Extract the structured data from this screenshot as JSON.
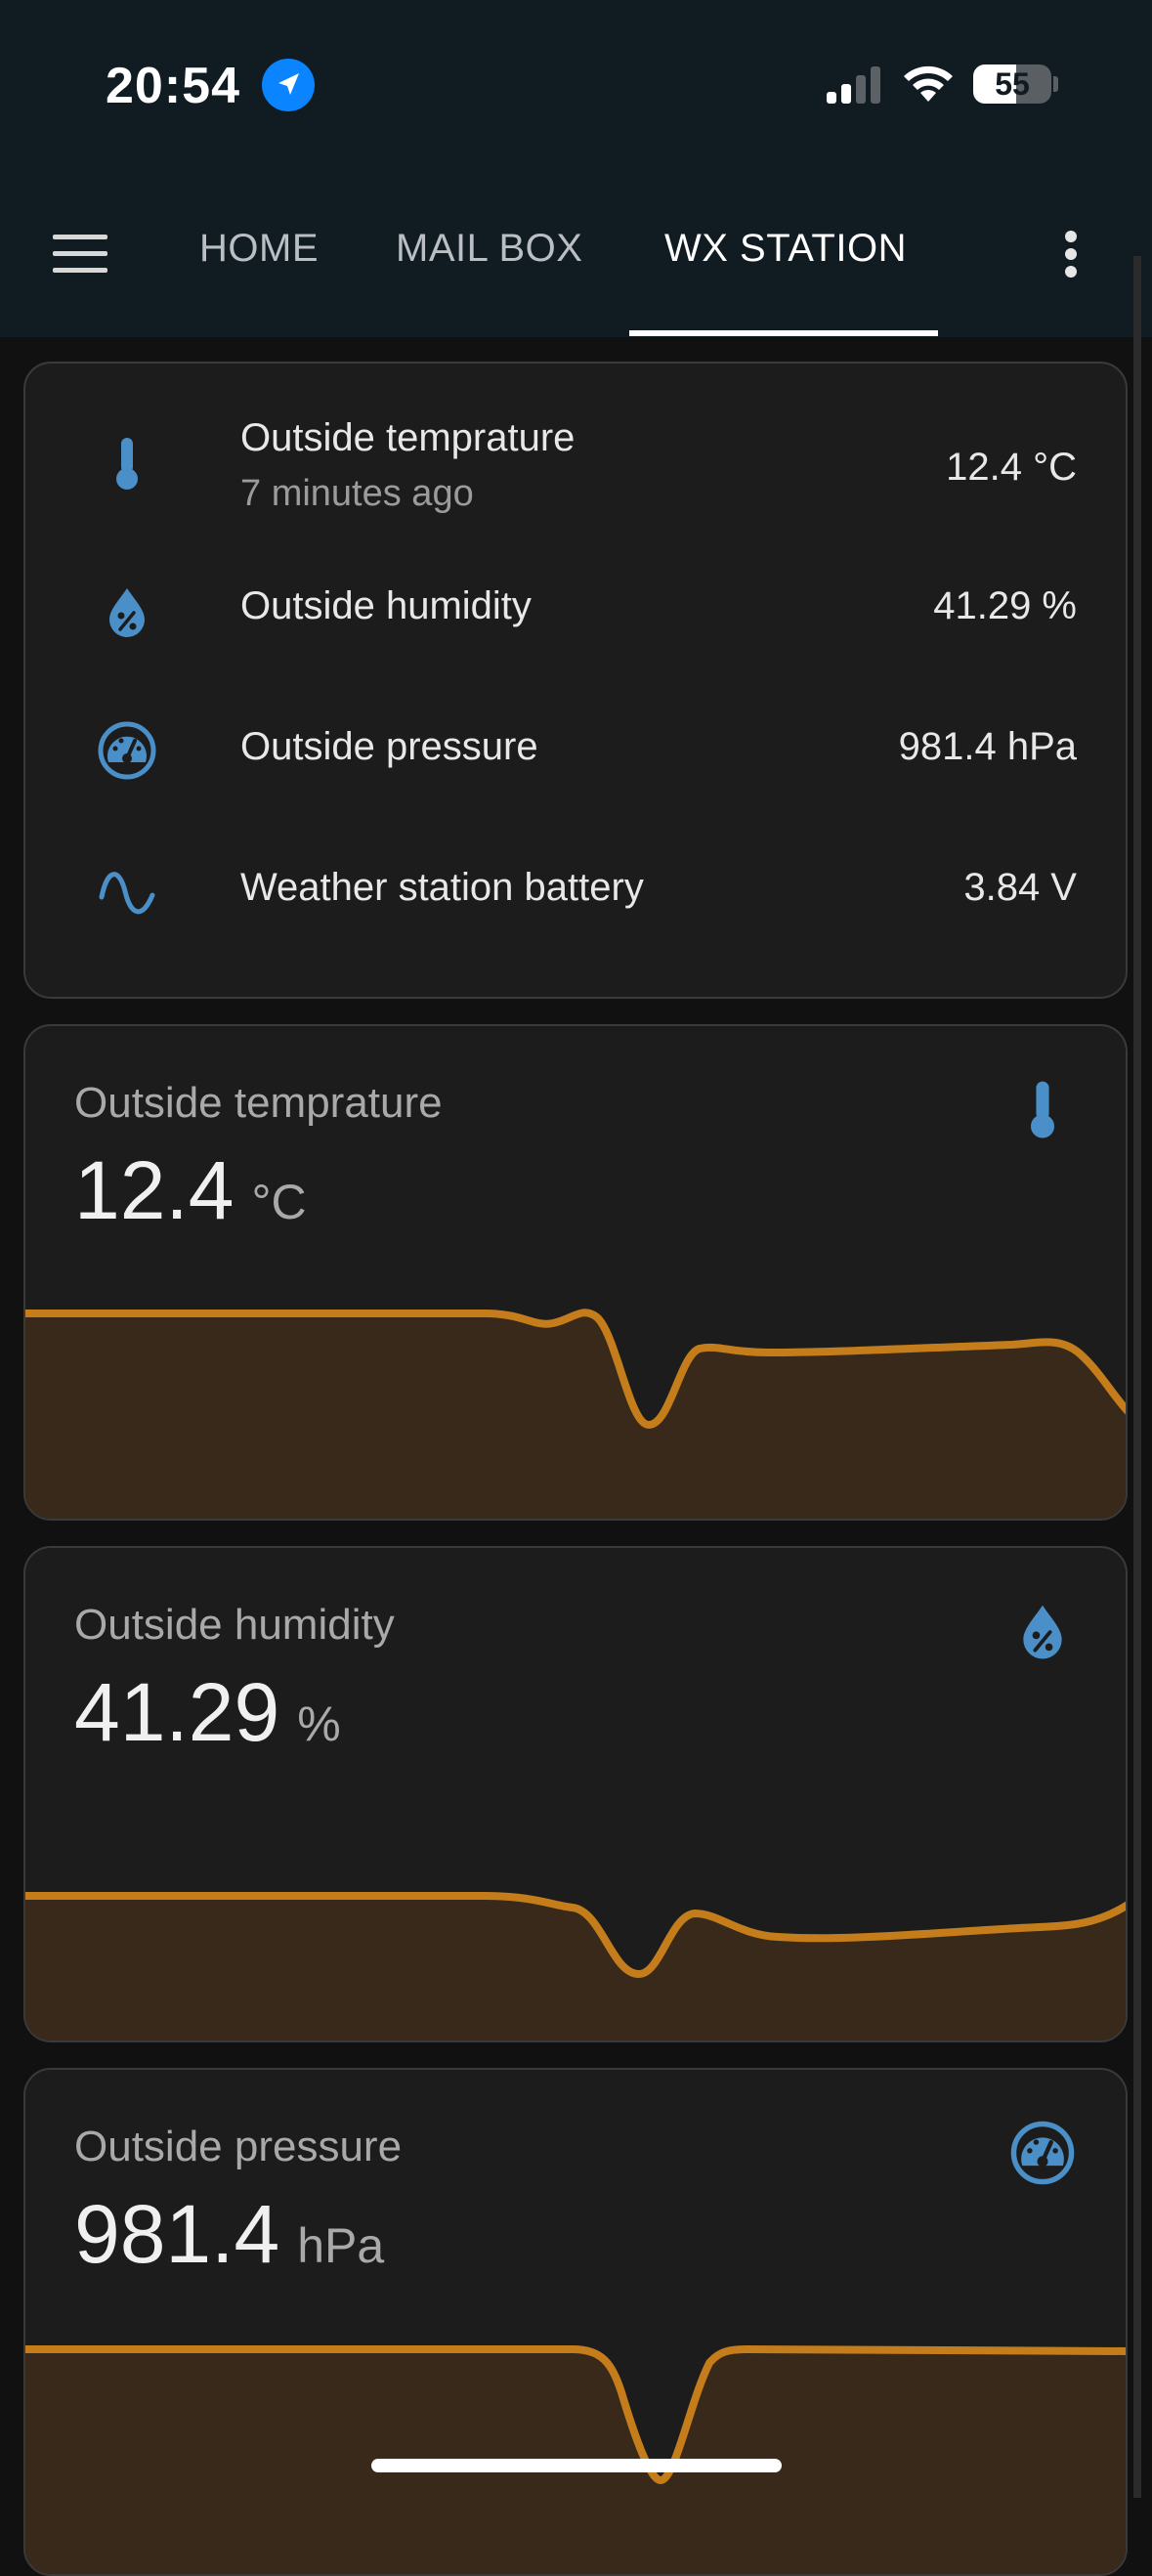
{
  "status_bar": {
    "time": "20:54",
    "battery": "55",
    "location_icon": "location-arrow-icon",
    "signal_icon": "cellular-signal-icon",
    "wifi_icon": "wifi-icon"
  },
  "toolbar": {
    "menu_icon": "hamburger-menu-icon",
    "tabs": [
      {
        "label": "HOME",
        "active": false
      },
      {
        "label": "MAIL BOX",
        "active": false
      },
      {
        "label": "WX STATION",
        "active": true
      }
    ],
    "overflow_icon": "more-vertical-icon"
  },
  "entities": [
    {
      "icon": "thermometer-icon",
      "label": "Outside temprature",
      "secondary": "7 minutes ago",
      "value": "12.4 °C"
    },
    {
      "icon": "water-percent-icon",
      "label": "Outside humidity",
      "value": "41.29 %"
    },
    {
      "icon": "gauge-icon",
      "label": "Outside pressure",
      "value": "981.4 hPa"
    },
    {
      "icon": "sine-wave-icon",
      "label": "Weather station battery",
      "value": "3.84 V"
    }
  ],
  "sensor_cards": [
    {
      "title": "Outside temprature",
      "value": "12.4",
      "unit": "°C",
      "icon": "thermometer-icon"
    },
    {
      "title": "Outside humidity",
      "value": "41.29",
      "unit": "%",
      "icon": "water-percent-icon"
    },
    {
      "title": "Outside pressure",
      "value": "981.4",
      "unit": "hPa",
      "icon": "gauge-icon"
    }
  ],
  "colors": {
    "header_bg": "#101b22",
    "card_bg": "#1c1c1c",
    "accent_icon": "#4a8fc7",
    "graph_line": "#c47d1a",
    "graph_fill": "#38291b"
  }
}
